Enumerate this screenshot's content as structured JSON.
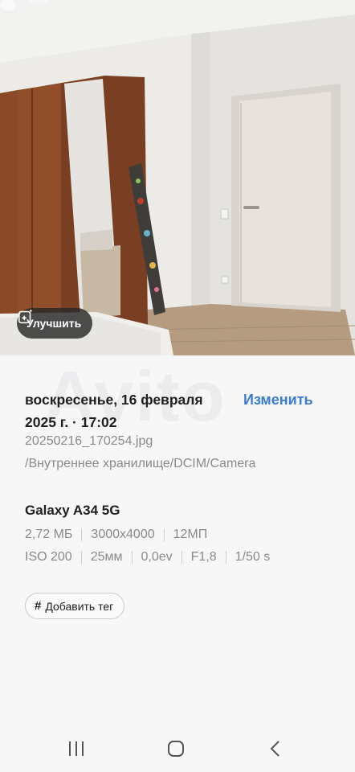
{
  "photo": {
    "enhance_label": "Улучшить",
    "enhance_icon": "sparkle-edit-icon"
  },
  "details": {
    "watermark": "Avito",
    "datetime": "воскресенье, 16 февраля 2025 г. · 17:02",
    "edit_label": "Изменить",
    "filename": "20250216_170254.jpg",
    "path": "/Внутреннее хранилище/DCIM/Camera",
    "device": "Galaxy A34 5G",
    "specs_row1": [
      "2,72 МБ",
      "3000x4000",
      "12МП"
    ],
    "specs_row2": [
      "ISO 200",
      "25мм",
      "0,0ev",
      "F1,8",
      "1/50 s"
    ],
    "tag_label": "Добавить тег",
    "tag_icon": "hash-icon"
  },
  "navbar": {
    "recents_icon": "recents-icon",
    "home_icon": "home-icon",
    "back_icon": "back-icon"
  },
  "colors": {
    "accent": "#3a7bd5",
    "background": "#f7f7f8",
    "secondary_text": "#8a8a8a"
  }
}
